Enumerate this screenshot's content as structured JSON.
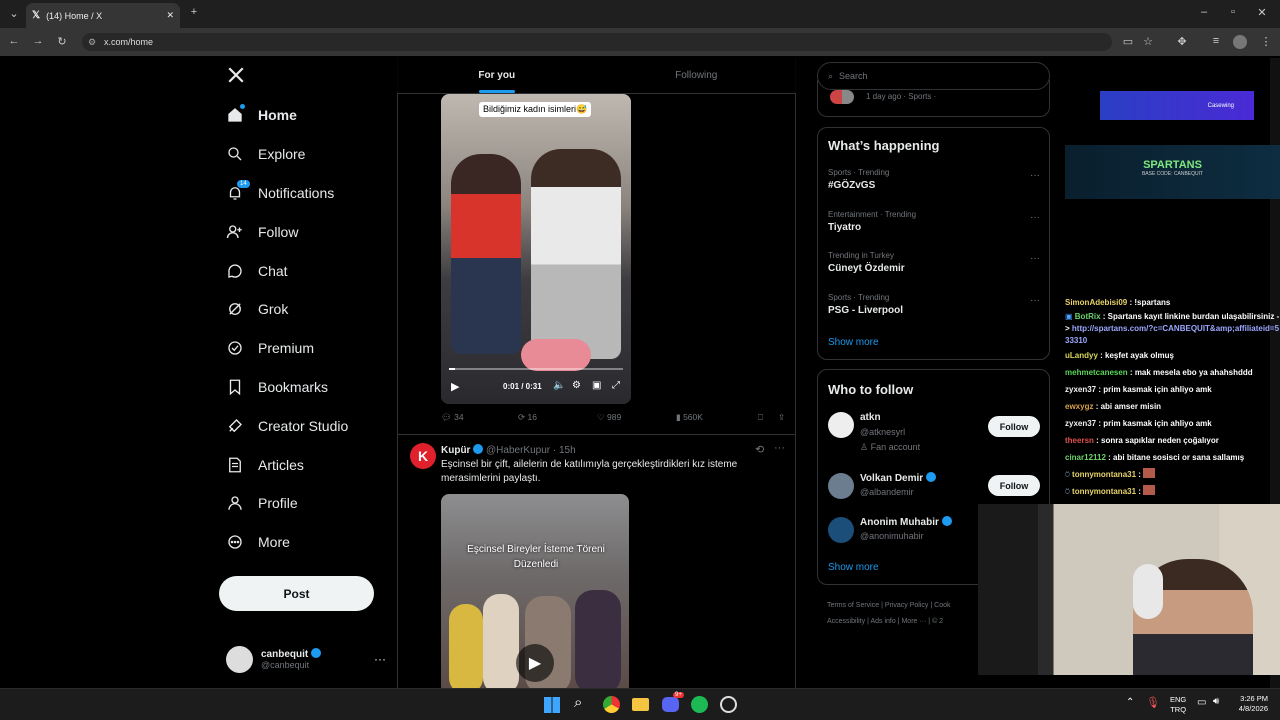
{
  "browser": {
    "tab_title": "(14) Home / X",
    "url": "x.com/home"
  },
  "nav": {
    "items": [
      {
        "label": "Home",
        "icon": "home-icon"
      },
      {
        "label": "Explore",
        "icon": "search-icon"
      },
      {
        "label": "Notifications",
        "icon": "bell-icon",
        "badge": "14"
      },
      {
        "label": "Follow",
        "icon": "person-add-icon"
      },
      {
        "label": "Chat",
        "icon": "chat-icon"
      },
      {
        "label": "Grok",
        "icon": "grok-icon"
      },
      {
        "label": "Premium",
        "icon": "premium-icon"
      },
      {
        "label": "Bookmarks",
        "icon": "bookmark-icon"
      },
      {
        "label": "Creator Studio",
        "icon": "rocket-icon"
      },
      {
        "label": "Articles",
        "icon": "articles-icon"
      },
      {
        "label": "Profile",
        "icon": "profile-icon"
      },
      {
        "label": "More",
        "icon": "more-icon"
      }
    ],
    "post_label": "Post",
    "account": {
      "name": "canbequit",
      "handle": "@canbequit"
    }
  },
  "timeline": {
    "tabs": [
      "For you",
      "Following"
    ],
    "post1": {
      "video_caption": "Bildiğimiz kadın isimleri😅",
      "time": "0:01 / 0:31",
      "replies": "34",
      "reposts": "16",
      "likes": "989",
      "views": "560K"
    },
    "post2": {
      "author": "Kupür",
      "handle": "@HaberKupur",
      "time": "· 15h",
      "text": "Eşcinsel bir çift, ailelerin de katılımıyla gerçekleştirdikleri kız isteme merasimlerini paylaştı.",
      "video_caption": "Eşcinsel Bireyler İsteme Töreni Düzenledi"
    }
  },
  "right": {
    "search_placeholder": "Search",
    "top_snippet": "1 day ago · Sports ·",
    "whats_happening": "What’s happening",
    "trends": [
      {
        "meta": "Sports · Trending",
        "name": "#GÖZvGS"
      },
      {
        "meta": "Entertainment · Trending",
        "name": "Tiyatro"
      },
      {
        "meta": "Trending in Turkey",
        "name": "Cüneyt Özdemir"
      },
      {
        "meta": "Sports · Trending",
        "name": "PSG - Liverpool"
      }
    ],
    "show_more": "Show more",
    "who_to_follow": "Who to follow",
    "follow_suggestions": [
      {
        "name": "atkn",
        "handle": "@atknesyrl",
        "note": "Fan account",
        "button": "Follow"
      },
      {
        "name": "Volkan Demir",
        "handle": "@albandemir",
        "button": "Follow"
      },
      {
        "name": "Anonim Muhabir",
        "handle": "@anonimuhabir"
      }
    ],
    "footer": [
      "Terms of Service",
      "Privacy Policy",
      "Cook",
      "Accessibility",
      "Ads info",
      "More ···",
      "© 2"
    ]
  },
  "overlay": {
    "banner1": "Casewing",
    "banner2_title": "SPARTANS",
    "banner2_sub": "BASE CODE: CANBEQUIT",
    "chat": [
      {
        "user": "SimonAdebisi09",
        "color": "#e8d36b",
        "msg": "!spartans"
      },
      {
        "user": "BotRix",
        "color": "#6bd36b",
        "msg": "Spartans kayıt linkine burdan ulaşabilirsiniz ->",
        "link": "http://spartans.com/?c=CANBEQUIT&amp;affiliateid=533310"
      },
      {
        "user": "uLandyy",
        "color": "#d6d65a",
        "msg": "keşfet ayak olmuş"
      },
      {
        "user": "mehmetcanesen",
        "color": "#5ad65a",
        "msg": "mak mesela ebo ya ahahshddd"
      },
      {
        "user": "zyxen37",
        "color": "#f0f0f0",
        "msg": "prim kasmak için ahliyo amk"
      },
      {
        "user": "ewxygz",
        "color": "#d6a04a",
        "msg": "abi amser misin"
      },
      {
        "user": "zyxen37",
        "color": "#f0f0f0",
        "msg": "prim kasmak için ahliyo amk"
      },
      {
        "user": "theersn",
        "color": "#e05050",
        "msg": "sonra sapıklar neden çoğalıyor"
      },
      {
        "user": "cinar12112",
        "color": "#6bd36b",
        "msg": "abi bitane sosisci or sana sallamış"
      },
      {
        "user": "tonnymontana31",
        "color": "#e8d36b",
        "msg": ""
      },
      {
        "user": "tonnymontana31",
        "color": "#e8d36b",
        "msg": ""
      }
    ]
  },
  "taskbar": {
    "lang": "ENG",
    "region": "TRQ",
    "time": "3:26 PM",
    "date": "4/8/2026",
    "discord_badge": "9+"
  },
  "colors": {
    "accent": "#1d9bf0",
    "background": "#000000",
    "border": "#2f3336"
  }
}
